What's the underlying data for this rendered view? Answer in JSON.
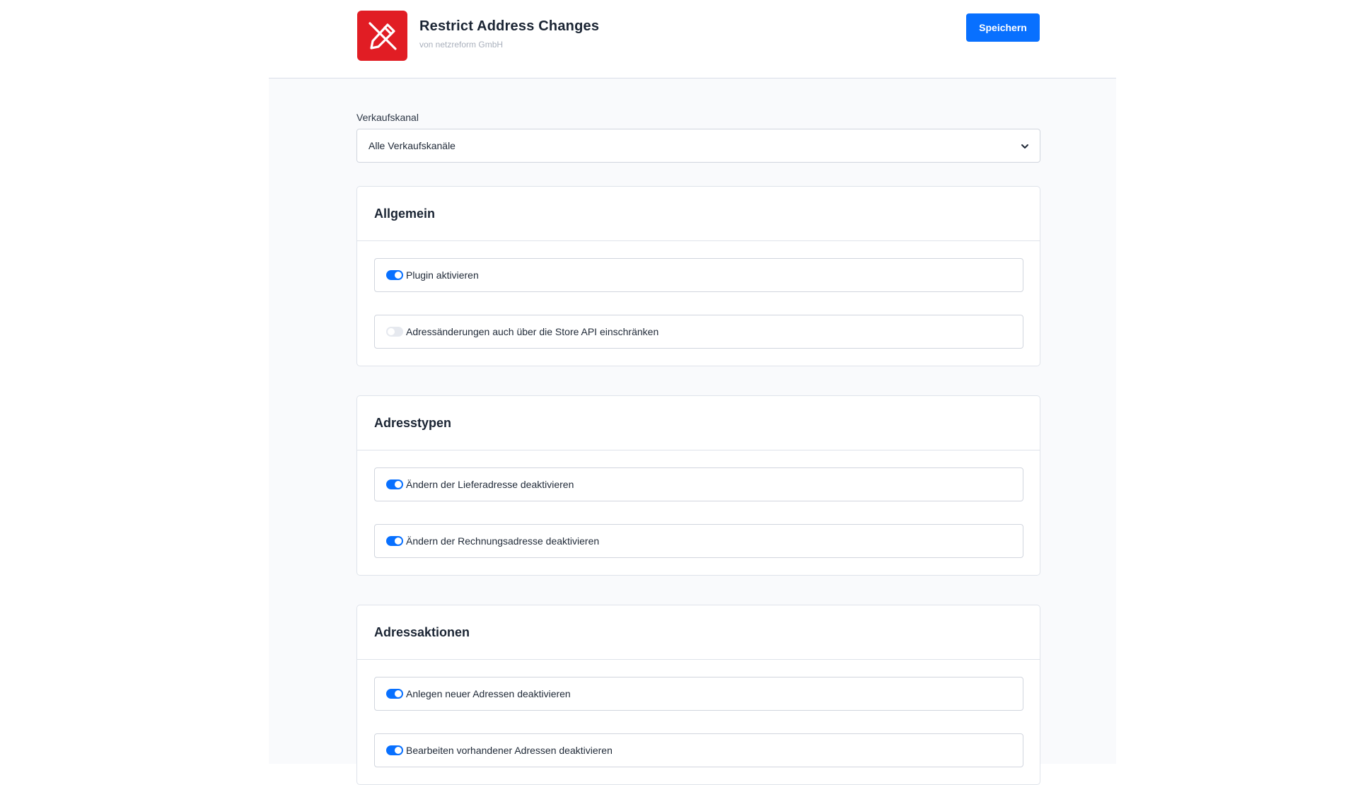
{
  "header": {
    "app_title": "Restrict Address Changes",
    "vendor": "von netzreform GmbH",
    "save_label": "Speichern",
    "icon": "pen-slash-icon",
    "brand_color": "#e11d24",
    "accent_color": "#0870ff"
  },
  "sales_channel": {
    "label": "Verkaufskanal",
    "selected": "Alle Verkaufskanäle"
  },
  "sections": [
    {
      "title": "Allgemein",
      "toggles": [
        {
          "label": "Plugin aktivieren",
          "enabled": true
        },
        {
          "label": "Adressänderungen auch über die Store API einschränken",
          "enabled": false
        }
      ]
    },
    {
      "title": "Adresstypen",
      "toggles": [
        {
          "label": "Ändern der Lieferadresse deaktivieren",
          "enabled": true
        },
        {
          "label": "Ändern der Rechnungsadresse deaktivieren",
          "enabled": true
        }
      ]
    },
    {
      "title": "Adressaktionen",
      "toggles": [
        {
          "label": "Anlegen neuer Adressen deaktivieren",
          "enabled": true
        },
        {
          "label": "Bearbeiten vorhandener Adressen deaktivieren",
          "enabled": true
        }
      ]
    }
  ]
}
